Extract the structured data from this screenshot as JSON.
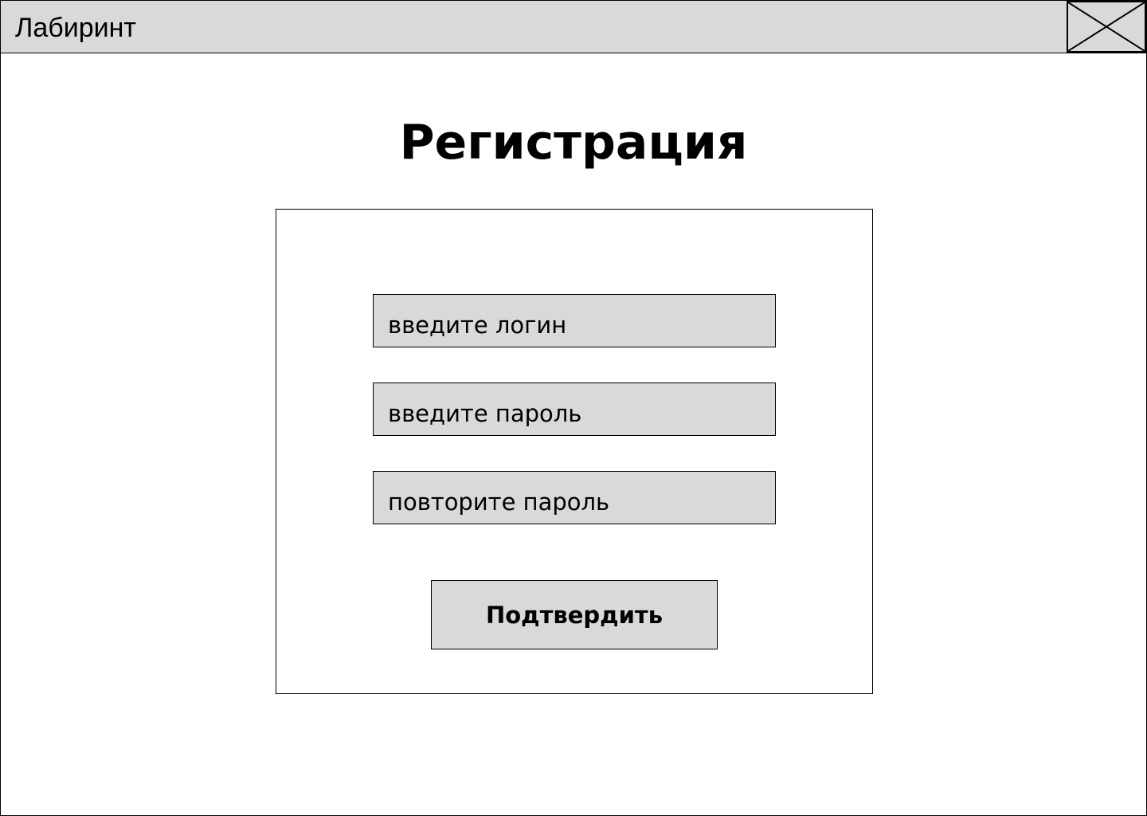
{
  "window": {
    "title": "Лабиринт",
    "close_icon": "close-x-icon"
  },
  "page": {
    "title": "Регистрация"
  },
  "form": {
    "login_placeholder": "введите логин",
    "password_placeholder": "введите пароль",
    "repeat_password_placeholder": "повторите пароль",
    "submit_label": "Подтвердить"
  },
  "colors": {
    "background": "#ffffff",
    "panel_fill": "#d9d9d9",
    "border": "#000000",
    "text": "#000000"
  }
}
